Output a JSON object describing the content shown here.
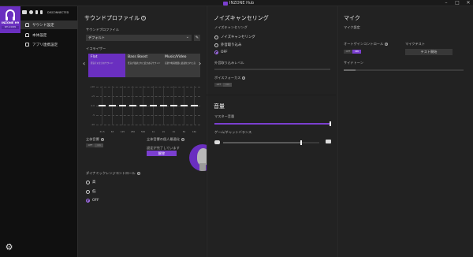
{
  "titlebar": {
    "title": "INZONE Hub",
    "min": "–",
    "max": "□",
    "close": "✕"
  },
  "device": {
    "name": "INZONE H9",
    "model": "WH-G900N",
    "status": "DISCONNECTED"
  },
  "sidebar": {
    "items": [
      {
        "label": "サウンド設定",
        "active": true
      },
      {
        "label": "本体設定",
        "active": false
      },
      {
        "label": "アプリ連携設定",
        "active": false
      }
    ]
  },
  "sound": {
    "title": "サウンドプロファイル",
    "profile_label": "サウンドプロファイル",
    "profile_value": "デフォルト",
    "eq_label": "イコライザー",
    "presets": [
      {
        "name": "Flat",
        "desc": "原音そのままのサウンド",
        "active": true
      },
      {
        "name": "Bass Boost",
        "desc": "低音が強調された迫力あるサウンド",
        "active": false
      },
      {
        "name": "Music/Video",
        "desc": "音楽や動画鑑賞に最適化された音",
        "active": false
      }
    ],
    "eq_ylabels": [
      "+10",
      "+5",
      "0.0",
      "-5",
      "-10"
    ],
    "eq_bands": [
      {
        "freq": "31.5",
        "gain": 0
      },
      {
        "freq": "63",
        "gain": 0
      },
      {
        "freq": "125",
        "gain": 0
      },
      {
        "freq": "250",
        "gain": 0
      },
      {
        "freq": "500",
        "gain": 0
      },
      {
        "freq": "1k",
        "gain": 0
      },
      {
        "freq": "2k",
        "gain": 0
      },
      {
        "freq": "4k",
        "gain": 0
      },
      {
        "freq": "8k",
        "gain": 0
      },
      {
        "freq": "16k",
        "gain": 0
      }
    ],
    "spatial_label": "立体音響",
    "toggle_off": "OFF",
    "toggle_on": "ON",
    "spatial_opt_label": "立体音響の個人最適化",
    "spatial_opt_desc": "設定が完了しています",
    "spatial_opt_button": "解除",
    "drc_label": "ダイナミックレンジコントロール",
    "drc_options": [
      {
        "label": "高",
        "selected": false
      },
      {
        "label": "低",
        "selected": false
      },
      {
        "label": "OFF",
        "selected": true
      }
    ]
  },
  "noise": {
    "title": "ノイズキャンセリング",
    "mode_label": "ノイズキャンセリング",
    "options": [
      {
        "label": "ノイズキャンセリング",
        "selected": false
      },
      {
        "label": "外音取り込み",
        "selected": false
      },
      {
        "label": "OFF",
        "selected": true
      }
    ],
    "ambient_level_label": "外音取り込みレベル",
    "voice_focus_label": "ボイスフォーカス",
    "voice_focus_off": "OFF",
    "voice_focus_on": "ON"
  },
  "volume": {
    "title": "音量",
    "master_label": "マスター音量",
    "master_level": 1.0,
    "balance_label": "ゲーム/チャットバランス",
    "balance_level": 0.82
  },
  "mic": {
    "title": "マイク",
    "settings_label": "マイク設定",
    "agc_label": "オートゲインコントロール",
    "agc_off": "OFF",
    "agc_on": "ON",
    "test_label": "マイクテスト",
    "test_button": "テスト開始",
    "sidetone_label": "サイドトーン",
    "sidetone_level": 0.1
  },
  "colors": {
    "accent": "#7b3fd0",
    "panel": "#222222",
    "sidebar": "#101010"
  }
}
